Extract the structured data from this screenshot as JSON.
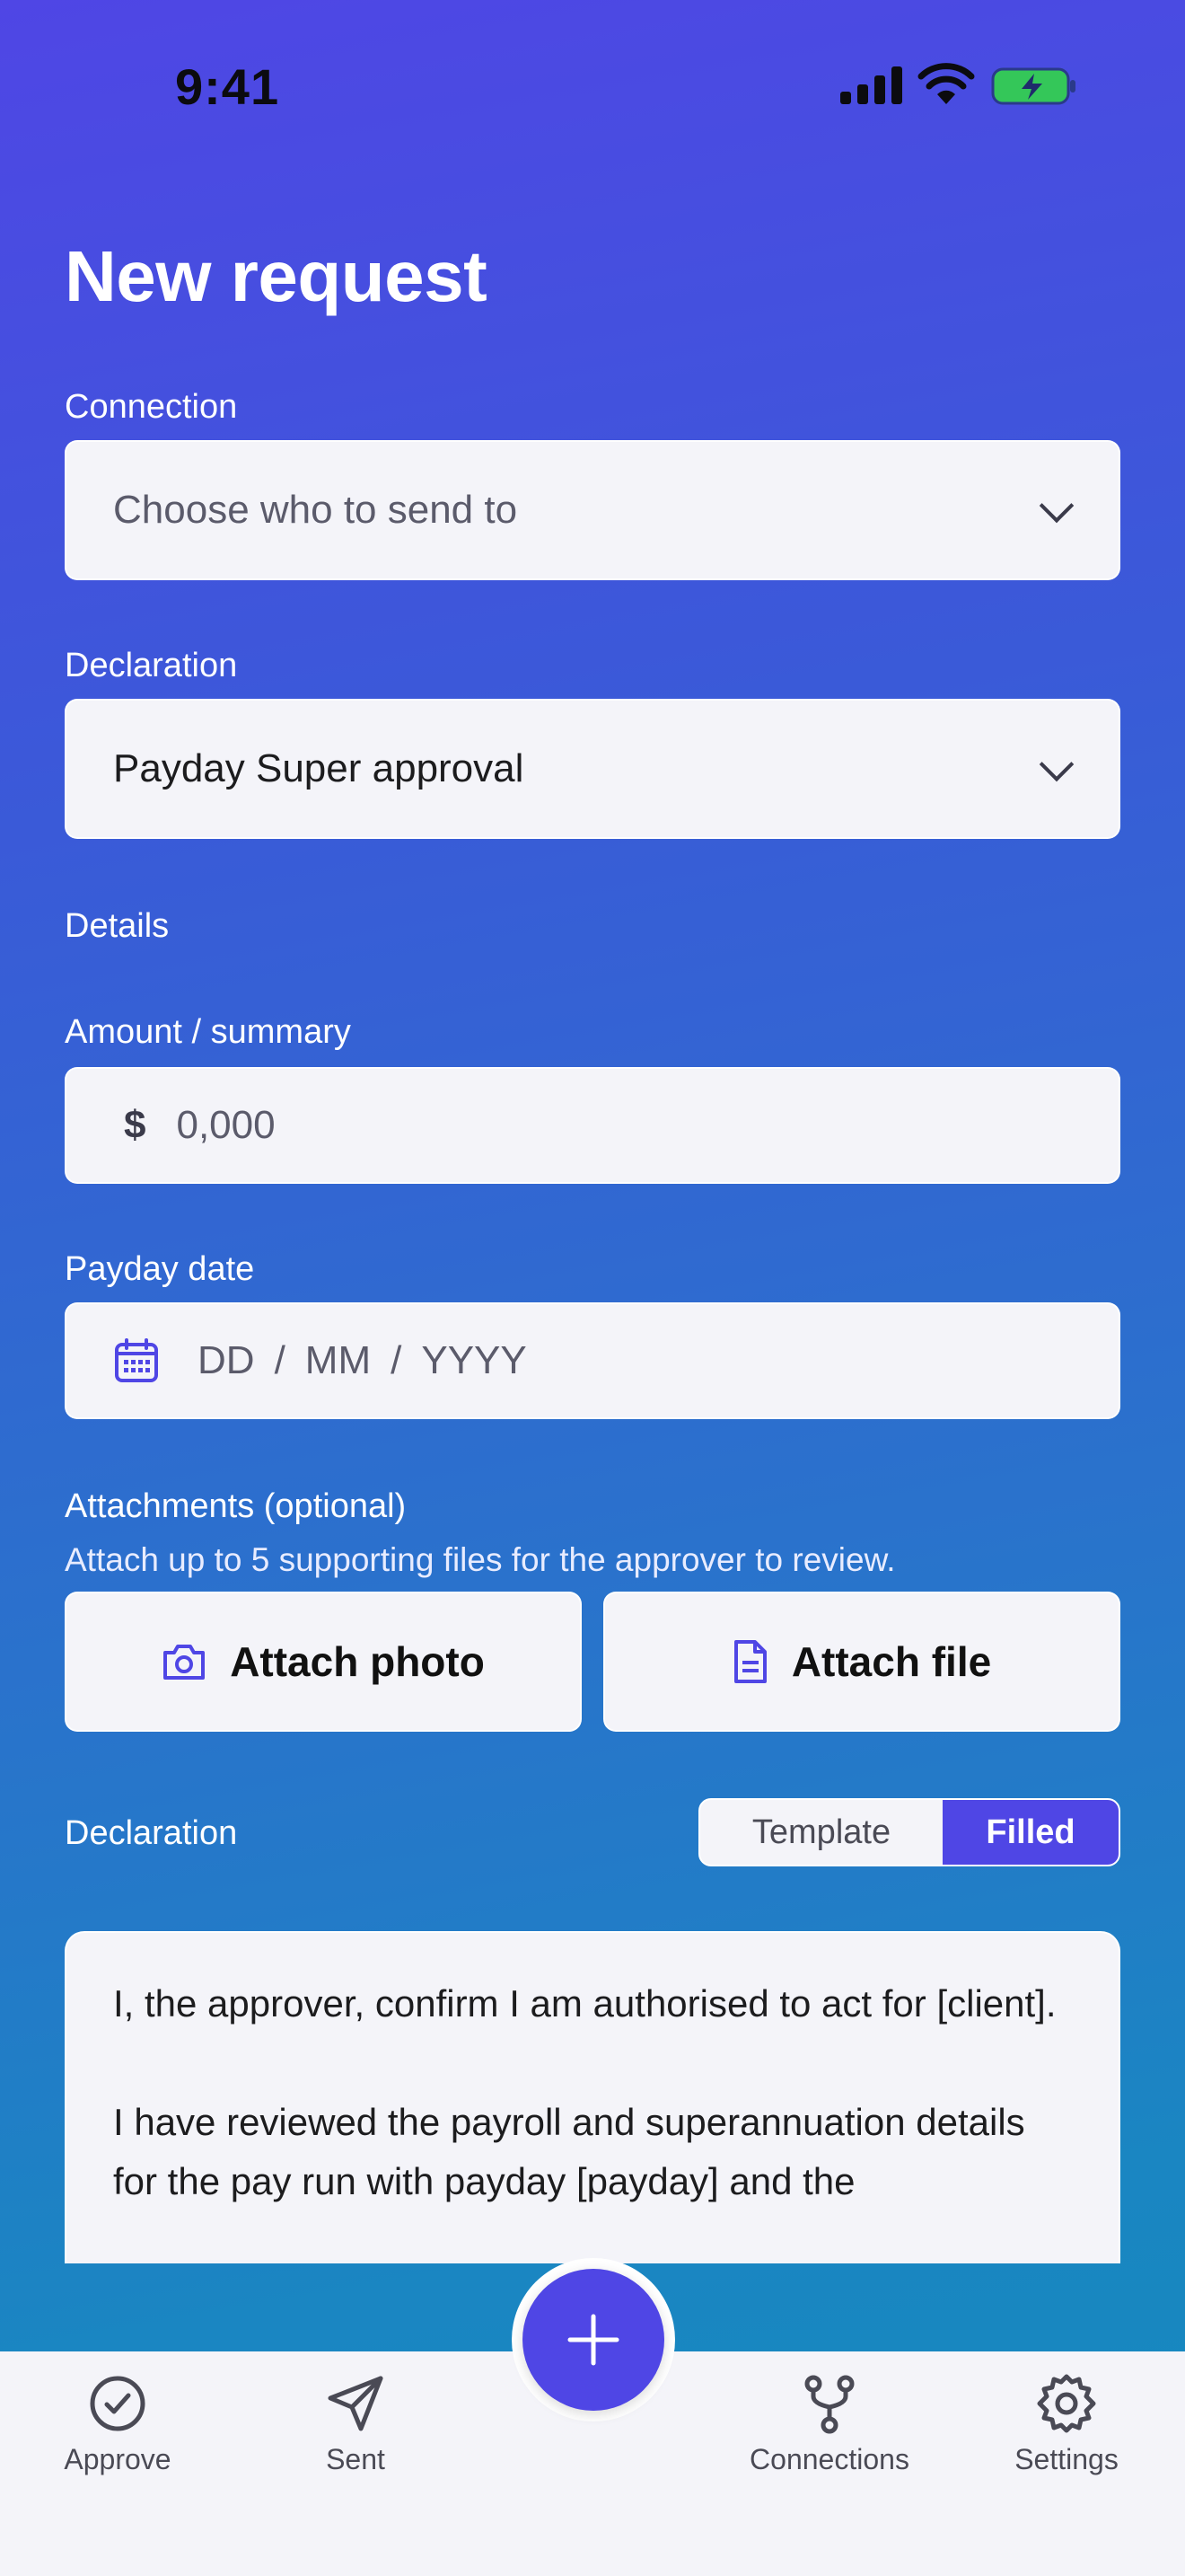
{
  "status_bar": {
    "time": "9:41"
  },
  "page_title": "New request",
  "connection": {
    "label": "Connection",
    "placeholder": "Choose who to send to"
  },
  "declaration_select": {
    "label": "Declaration",
    "value": "Payday Super approval"
  },
  "details_heading": "Details",
  "amount": {
    "label": "Amount / summary",
    "prefix": "$",
    "placeholder": "0,000"
  },
  "payday_date": {
    "label": "Payday date",
    "dd": "DD",
    "mm": "MM",
    "yyyy": "YYYY",
    "sep": "/"
  },
  "attachments": {
    "label": "Attachments (optional)",
    "hint": "Attach up to 5 supporting files for the approver to review.",
    "photo_button": "Attach photo",
    "file_button": "Attach file"
  },
  "declaration_text": {
    "label": "Declaration",
    "toggle": {
      "template": "Template",
      "filled": "Filled",
      "selected": "Filled"
    },
    "paragraph_1": "I, the approver, confirm I am authorised to act for [client].",
    "paragraph_2": "I have reviewed the payroll and superannuation details for the pay run with payday [payday] and the"
  },
  "tab_bar": {
    "approve": "Approve",
    "sent": "Sent",
    "connections": "Connections",
    "settings": "Settings"
  },
  "colors": {
    "accent": "#4f46e5",
    "field_bg": "#f4f4f9",
    "battery_fill": "#34c759"
  }
}
